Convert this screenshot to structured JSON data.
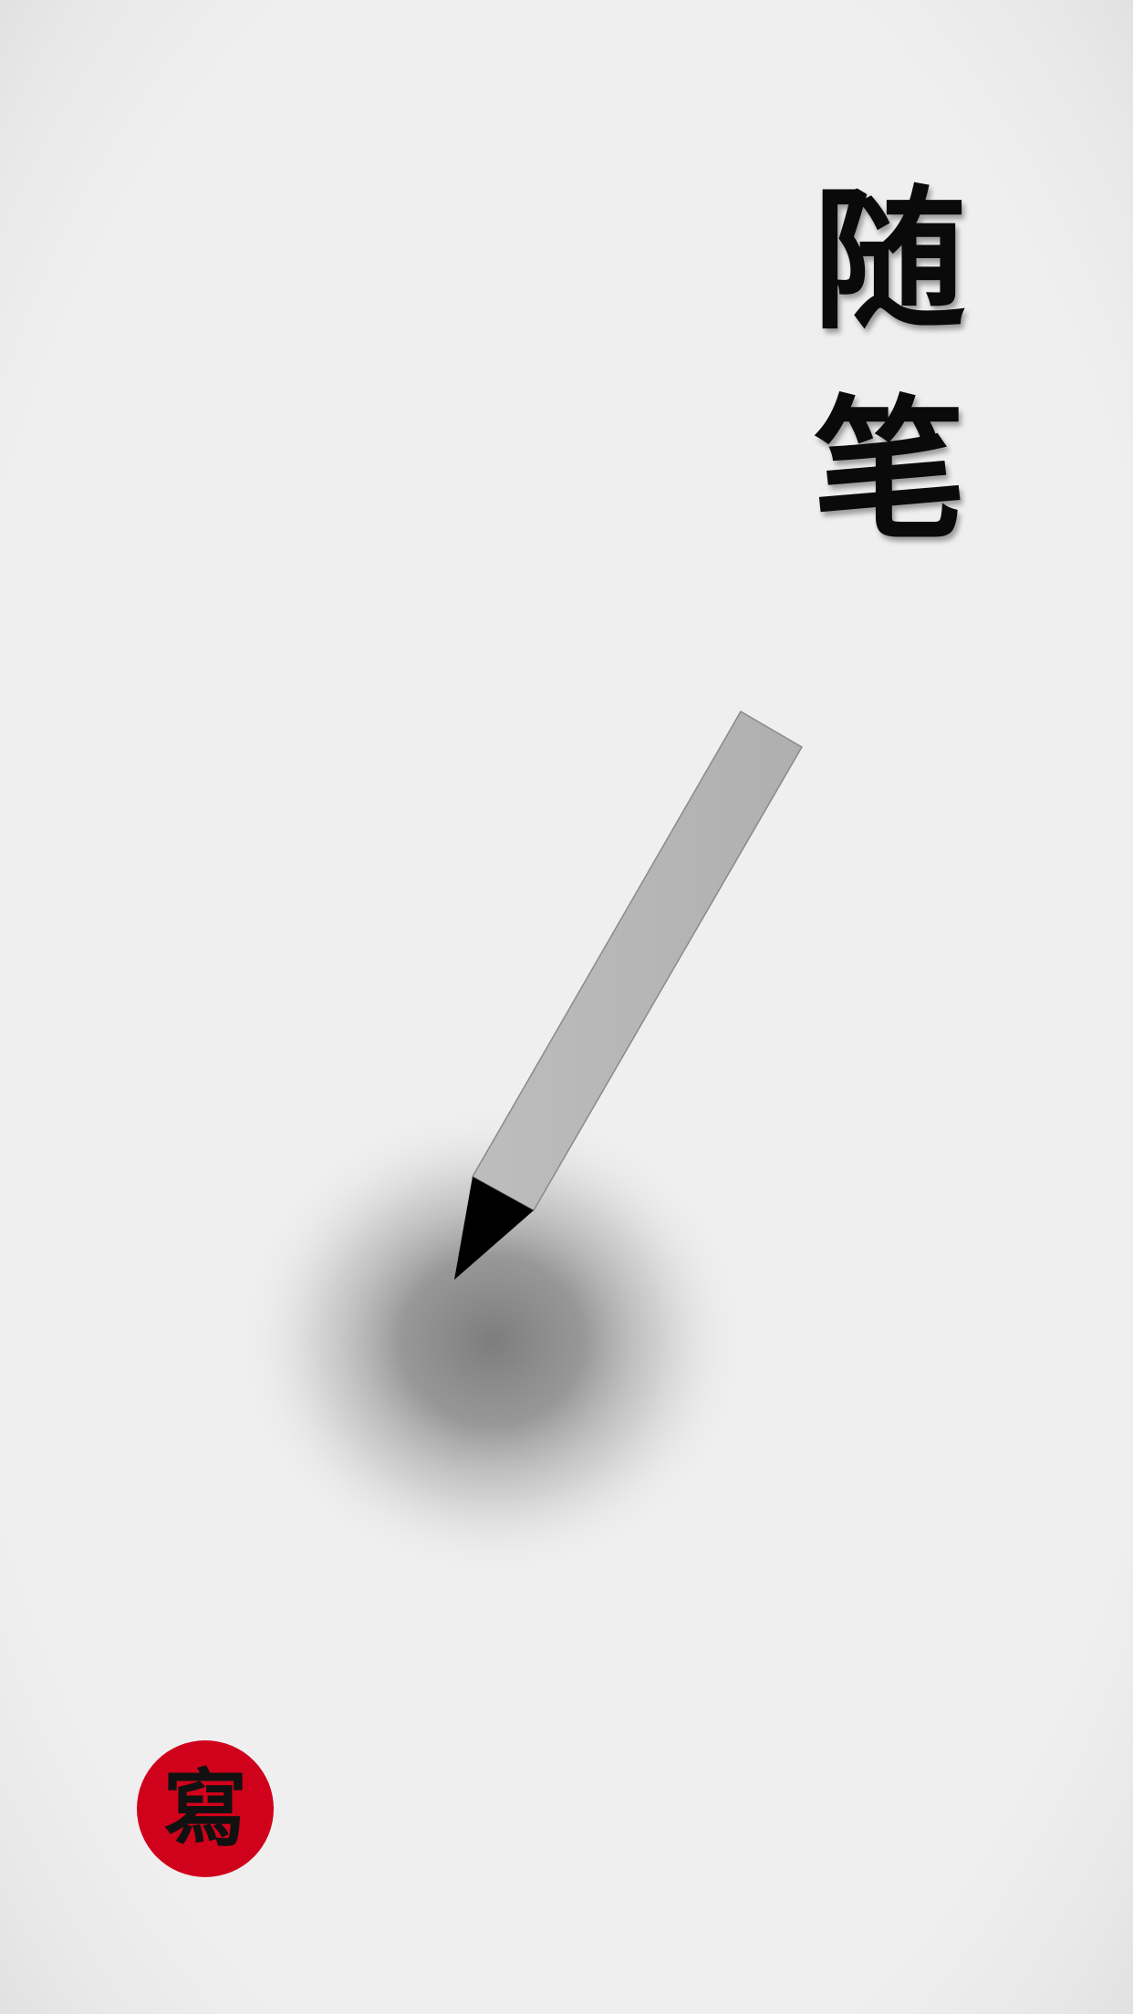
{
  "title": {
    "line1": "随",
    "line2": "笔"
  },
  "seal": {
    "label": "寫",
    "color": "#d0021b"
  },
  "icons": {
    "pen": "pencil-icon",
    "ink": "ink-drop"
  },
  "colors": {
    "background": "#f0eff0",
    "pen_body": "#b6b6b6",
    "pen_tip": "#000000",
    "text": "#0a0a0a"
  }
}
